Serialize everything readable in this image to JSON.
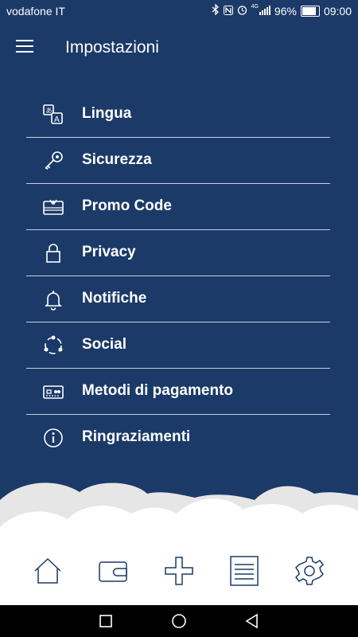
{
  "status": {
    "carrier": "vodafone IT",
    "network": "4G",
    "battery": "96%",
    "time": "09:00"
  },
  "header": {
    "title": "Impostazioni"
  },
  "settings": {
    "items": [
      {
        "label": "Lingua",
        "icon": "language-icon"
      },
      {
        "label": "Sicurezza",
        "icon": "key-icon"
      },
      {
        "label": "Promo Code",
        "icon": "gift-card-icon"
      },
      {
        "label": "Privacy",
        "icon": "lock-icon"
      },
      {
        "label": "Notifiche",
        "icon": "bell-icon"
      },
      {
        "label": "Social",
        "icon": "share-icon"
      },
      {
        "label": "Metodi di pagamento",
        "icon": "credit-card-icon"
      },
      {
        "label": "Ringraziamenti",
        "icon": "info-icon"
      }
    ]
  },
  "bottom_nav": {
    "items": [
      "home-icon",
      "wallet-icon",
      "plus-icon",
      "list-icon",
      "gear-icon"
    ]
  },
  "colors": {
    "background": "#1b3a68",
    "nav_icons": "#1b3a68",
    "divider": "#c7cfdc"
  }
}
